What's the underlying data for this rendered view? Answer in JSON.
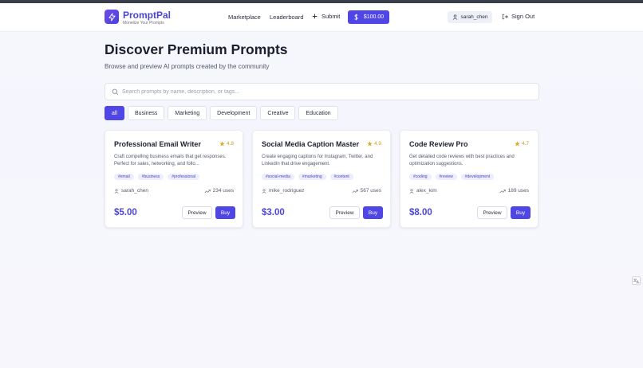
{
  "brand": {
    "name": "PromptPal",
    "tagline": "Monetize Your Prompts"
  },
  "nav": {
    "marketplace": "Marketplace",
    "leaderboard": "Leaderboard",
    "submit": "Submit",
    "balance": "$100.00",
    "username": "sarah_chen",
    "signout": "Sign Out"
  },
  "hero": {
    "title": "Discover Premium Prompts",
    "subtitle": "Browse and preview AI prompts created by the community"
  },
  "search": {
    "placeholder": "Search prompts by name, description, or tags...",
    "value": ""
  },
  "filters": [
    "all",
    "Business",
    "Marketing",
    "Development",
    "Creative",
    "Education"
  ],
  "active_filter": "all",
  "cards": [
    {
      "title": "Professional Email Writer",
      "rating": "4.8",
      "description": "Craft compelling business emails that get responses. Perfect for sales, networking, and follo...",
      "tags": [
        "#email",
        "#business",
        "#professional"
      ],
      "author": "sarah_chen",
      "uses": "234 uses",
      "price": "$5.00",
      "preview": "Preview",
      "buy": "Buy"
    },
    {
      "title": "Social Media Caption Master",
      "rating": "4.9",
      "description": "Create engaging captions for Instagram, Twitter, and LinkedIn that drive engagement.",
      "tags": [
        "#social-media",
        "#marketing",
        "#content"
      ],
      "author": "mike_rodriguez",
      "uses": "567 uses",
      "price": "$3.00",
      "preview": "Preview",
      "buy": "Buy"
    },
    {
      "title": "Code Review Pro",
      "rating": "4.7",
      "description": "Get detailed code reviews with best practices and optimization suggestions.",
      "tags": [
        "#coding",
        "#review",
        "#development"
      ],
      "author": "alex_kim",
      "uses": "189 uses",
      "price": "$8.00",
      "preview": "Preview",
      "buy": "Buy"
    }
  ],
  "colors": {
    "accent": "#4f46e5",
    "star": "#e0a82e",
    "tag_bg": "#eceefb"
  },
  "icons": {
    "logo": "sparkle-icon",
    "submit": "plus-icon",
    "balance": "dollar-icon",
    "user": "user-icon",
    "signout": "sign-out-icon",
    "search": "search-icon",
    "rating": "star-icon",
    "uses": "trending-up-icon",
    "corner": "translate-icon"
  }
}
